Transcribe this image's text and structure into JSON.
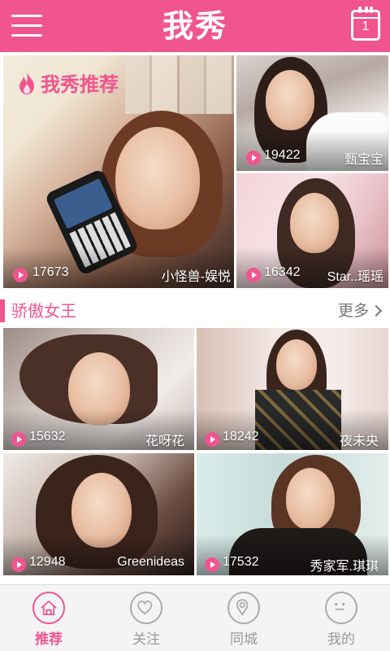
{
  "header": {
    "title": "我秀",
    "calendar_day": "1"
  },
  "featured": {
    "label": "我秀推荐",
    "main": {
      "views": "17673",
      "name": "小怪兽-娱悦"
    },
    "side": [
      {
        "views": "19422",
        "name": "甄宝宝"
      },
      {
        "views": "16342",
        "name": "Star..瑶瑶"
      }
    ]
  },
  "section": {
    "title": "骄傲女王",
    "more_label": "更多"
  },
  "grid": [
    {
      "views": "15632",
      "name": "花呀花"
    },
    {
      "views": "18242",
      "name": "夜未央"
    },
    {
      "views": "12948",
      "name": "Greenideas"
    },
    {
      "views": "17532",
      "name": "秀家军.琪琪"
    }
  ],
  "nav": [
    {
      "label": "推荐",
      "active": true
    },
    {
      "label": "关注",
      "active": false
    },
    {
      "label": "同城",
      "active": false
    },
    {
      "label": "我的",
      "active": false
    }
  ],
  "colors": {
    "accent": "#f0558f",
    "nav_bg": "#f4f4f4",
    "inactive": "#999999"
  },
  "icons": {
    "menu": "hamburger-icon",
    "calendar": "calendar-icon",
    "play": "play-icon",
    "flame": "flame-icon",
    "nav": [
      "home-icon",
      "heart-icon",
      "location-pin-icon",
      "face-icon"
    ]
  }
}
